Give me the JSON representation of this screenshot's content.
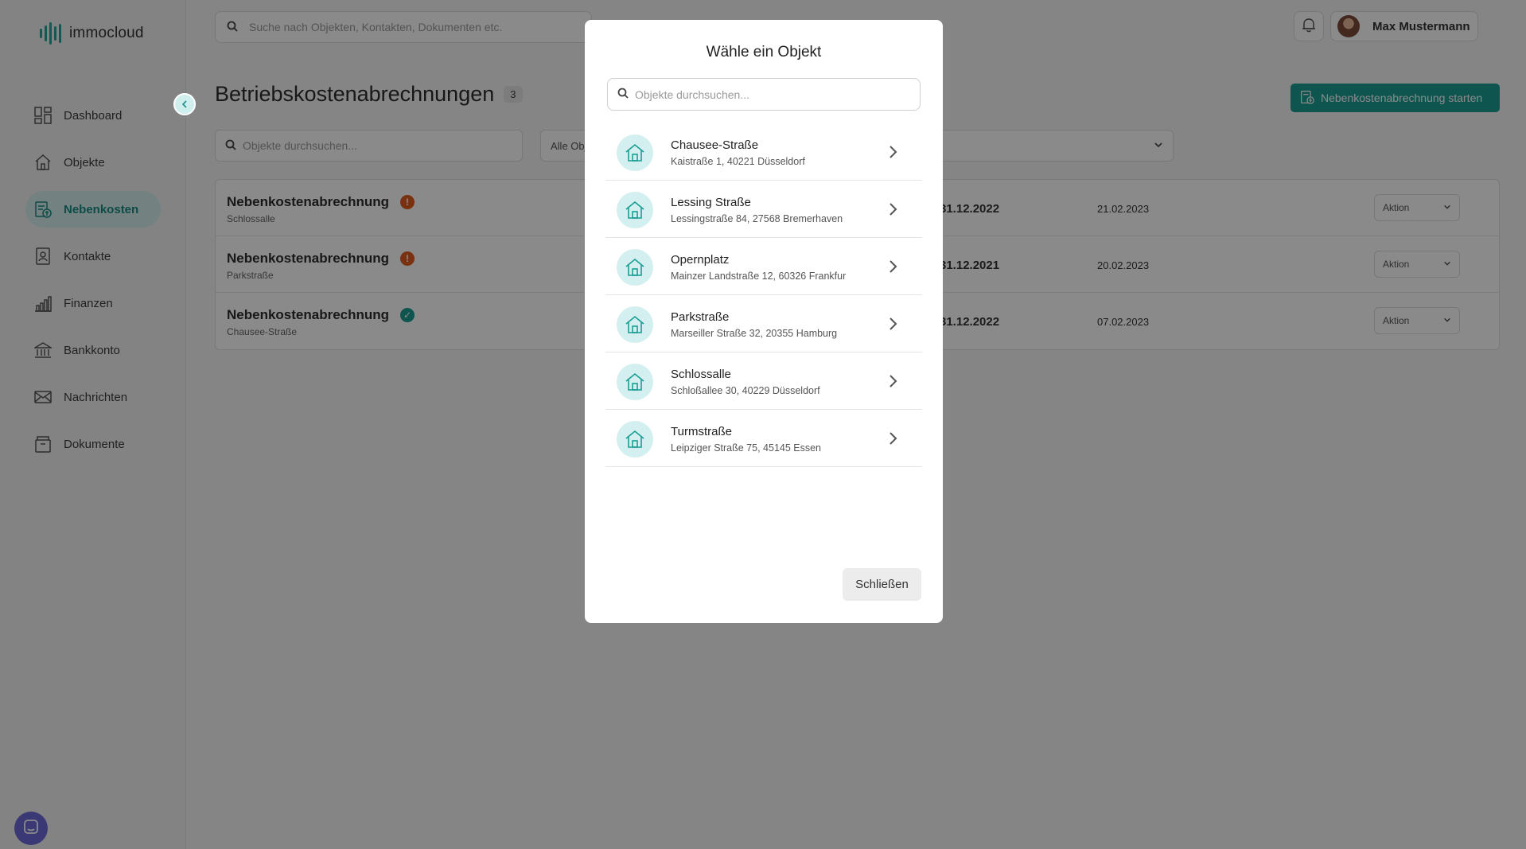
{
  "app": {
    "logo_text": "immocloud"
  },
  "sidebar": {
    "items": [
      {
        "label": "Dashboard",
        "icon": "dashboard-icon"
      },
      {
        "label": "Objekte",
        "icon": "house-icon"
      },
      {
        "label": "Nebenkosten",
        "icon": "utility-bill-icon",
        "active": true
      },
      {
        "label": "Kontakte",
        "icon": "contact-card-icon"
      },
      {
        "label": "Finanzen",
        "icon": "bar-chart-icon"
      },
      {
        "label": "Bankkonto",
        "icon": "bank-icon"
      },
      {
        "label": "Nachrichten",
        "icon": "envelope-icon"
      },
      {
        "label": "Dokumente",
        "icon": "archive-box-icon"
      }
    ]
  },
  "header": {
    "search_placeholder": "Suche nach Objekten, Kontakten, Dokumenten etc.",
    "user_name": "Max Mustermann"
  },
  "main": {
    "title": "Betriebskostenabrechnungen",
    "count": "3",
    "start_button": "Nebenkostenabrechnung starten",
    "search_placeholder": "Objekte durchsuchen...",
    "filter_value": "Alle Objekte",
    "rows": [
      {
        "title": "Nebenkostenabrechnung",
        "subtitle": "Schlossalle",
        "status": "warning",
        "status_symbol": "!",
        "date1": "31.12.2022",
        "date2": "21.02.2023",
        "action": "Aktion"
      },
      {
        "title": "Nebenkostenabrechnung",
        "subtitle": "Parkstraße",
        "status": "warning",
        "status_symbol": "!",
        "date1": "31.12.2021",
        "date2": "20.02.2023",
        "action": "Aktion"
      },
      {
        "title": "Nebenkostenabrechnung",
        "subtitle": "Chausee-Straße",
        "status": "done",
        "status_symbol": "✓",
        "date1": "31.12.2022",
        "date2": "07.02.2023",
        "action": "Aktion"
      }
    ]
  },
  "modal": {
    "title": "Wähle ein Objekt",
    "search_placeholder": "Objekte durchsuchen...",
    "items": [
      {
        "name": "Chausee-Straße",
        "address": "Kaistraße 1, 40221 Düsseldorf"
      },
      {
        "name": "Lessing Straße",
        "address": "Lessingstraße 84, 27568 Bremerhaven"
      },
      {
        "name": "Opernplatz",
        "address": "Mainzer Landstraße 12, 60326 Frankfur"
      },
      {
        "name": "Parkstraße",
        "address": "Marseiller Straße 32, 20355 Hamburg"
      },
      {
        "name": "Schlossalle",
        "address": "Schloßallee 30, 40229 Düsseldorf"
      },
      {
        "name": "Turmstraße",
        "address": "Leipziger Straße 75, 45145 Essen"
      }
    ],
    "close_label": "Schließen"
  },
  "colors": {
    "accent": "#1a9e94",
    "warning": "#e25c1f",
    "active_bg": "#d7eeee"
  }
}
